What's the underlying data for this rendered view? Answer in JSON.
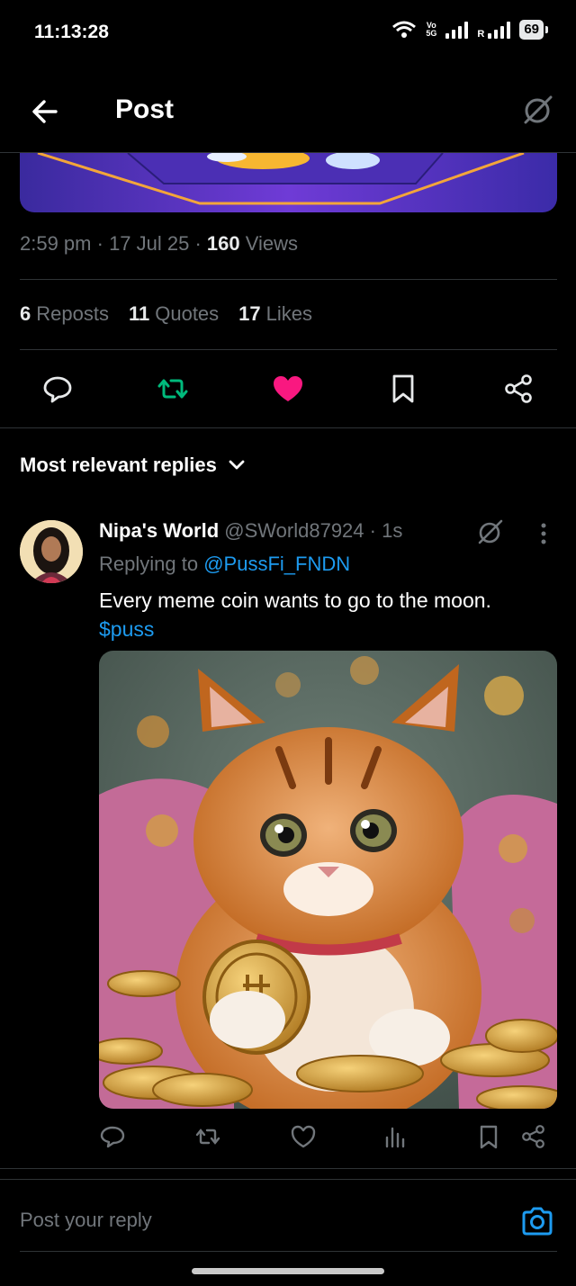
{
  "status_bar": {
    "time": "11:13:28",
    "volte_top": "Vo",
    "volte_bottom": "5G",
    "roaming": "R",
    "battery": "69"
  },
  "header": {
    "title": "Post"
  },
  "post_meta": {
    "time": "2:59 pm",
    "date": "17 Jul 25",
    "views_count": "160",
    "views_label": "Views"
  },
  "stats": {
    "reposts_count": "6",
    "reposts_label": "Reposts",
    "quotes_count": "11",
    "quotes_label": "Quotes",
    "likes_count": "17",
    "likes_label": "Likes"
  },
  "colors": {
    "repost_active": "#00ba7c",
    "like_active": "#f91880",
    "link": "#1d9bf0",
    "muted": "#71767b"
  },
  "sort": {
    "label": "Most relevant replies"
  },
  "reply": {
    "name": "Nipa's World",
    "handle": "@SWorld87924",
    "age": "1s",
    "replying_prefix": "Replying to",
    "replying_to": "@PussFi_FNDN",
    "text": "Every meme coin wants to go to the moon.",
    "cashtag": "$puss"
  },
  "compose": {
    "placeholder": "Post your reply"
  },
  "icons": [
    "back-arrow-icon",
    "grok-icon",
    "comment-icon",
    "repost-icon",
    "heart-icon",
    "bookmark-icon",
    "share-icon",
    "more-icon",
    "analytics-icon",
    "camera-icon",
    "chevron-down-icon"
  ]
}
